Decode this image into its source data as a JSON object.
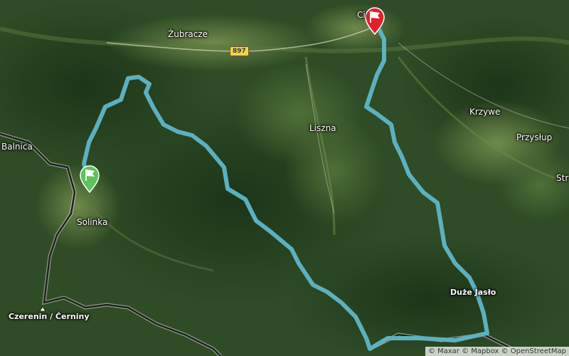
{
  "map": {
    "places": {
      "zubracze": "Żubracze",
      "balnica": "Balnica",
      "solinka": "Solinka",
      "liszna": "Liszna",
      "krzywe": "Krzywe",
      "przystup": "Przysłup",
      "str": "Str",
      "cisna": "Ci",
      "duze_jaslo": "Duże Jasło",
      "czerenin": "Czerenin / Černiny"
    },
    "road_shield": "897",
    "attribution": "© Maxar © Mapbox © OpenStreetMap",
    "colors": {
      "route": "#5fb6c8",
      "start_marker": "#5cc45a",
      "end_marker": "#e0202a",
      "border": "#1f1f1f"
    },
    "icons": {
      "start": "start-flag-marker-icon",
      "end": "finish-flag-marker-icon",
      "peak": "peak-triangle-icon"
    }
  }
}
